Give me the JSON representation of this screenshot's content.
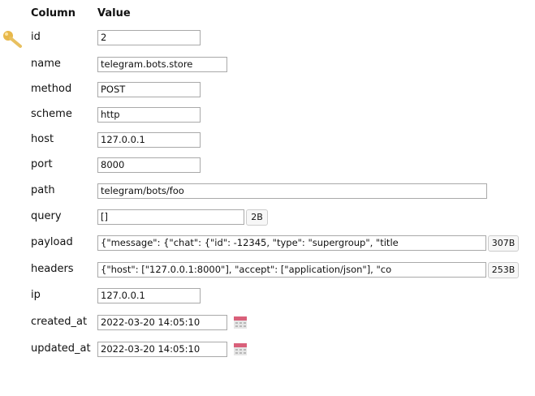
{
  "headers": {
    "column": "Column",
    "value": "Value"
  },
  "rows": [
    {
      "label": "id",
      "value": "2"
    },
    {
      "label": "name",
      "value": "telegram.bots.store"
    },
    {
      "label": "method",
      "value": "POST"
    },
    {
      "label": "scheme",
      "value": "http"
    },
    {
      "label": "host",
      "value": "127.0.0.1"
    },
    {
      "label": "port",
      "value": "8000"
    },
    {
      "label": "path",
      "value": "telegram/bots/foo"
    },
    {
      "label": "query",
      "value": "[]",
      "size": "2B"
    },
    {
      "label": "payload",
      "value": "{\"message\": {\"chat\": {\"id\": -12345, \"type\": \"supergroup\", \"title",
      "size": "307B"
    },
    {
      "label": "headers",
      "value": "{\"host\": [\"127.0.0.1:8000\"], \"accept\": [\"application/json\"], \"co",
      "size": "253B"
    },
    {
      "label": "ip",
      "value": "127.0.0.1"
    },
    {
      "label": "created_at",
      "value": "2022-03-20 14:05:10"
    },
    {
      "label": "updated_at",
      "value": "2022-03-20 14:05:10"
    }
  ],
  "icons": {
    "primary_key": "key-icon",
    "calendar": "calendar-icon"
  }
}
